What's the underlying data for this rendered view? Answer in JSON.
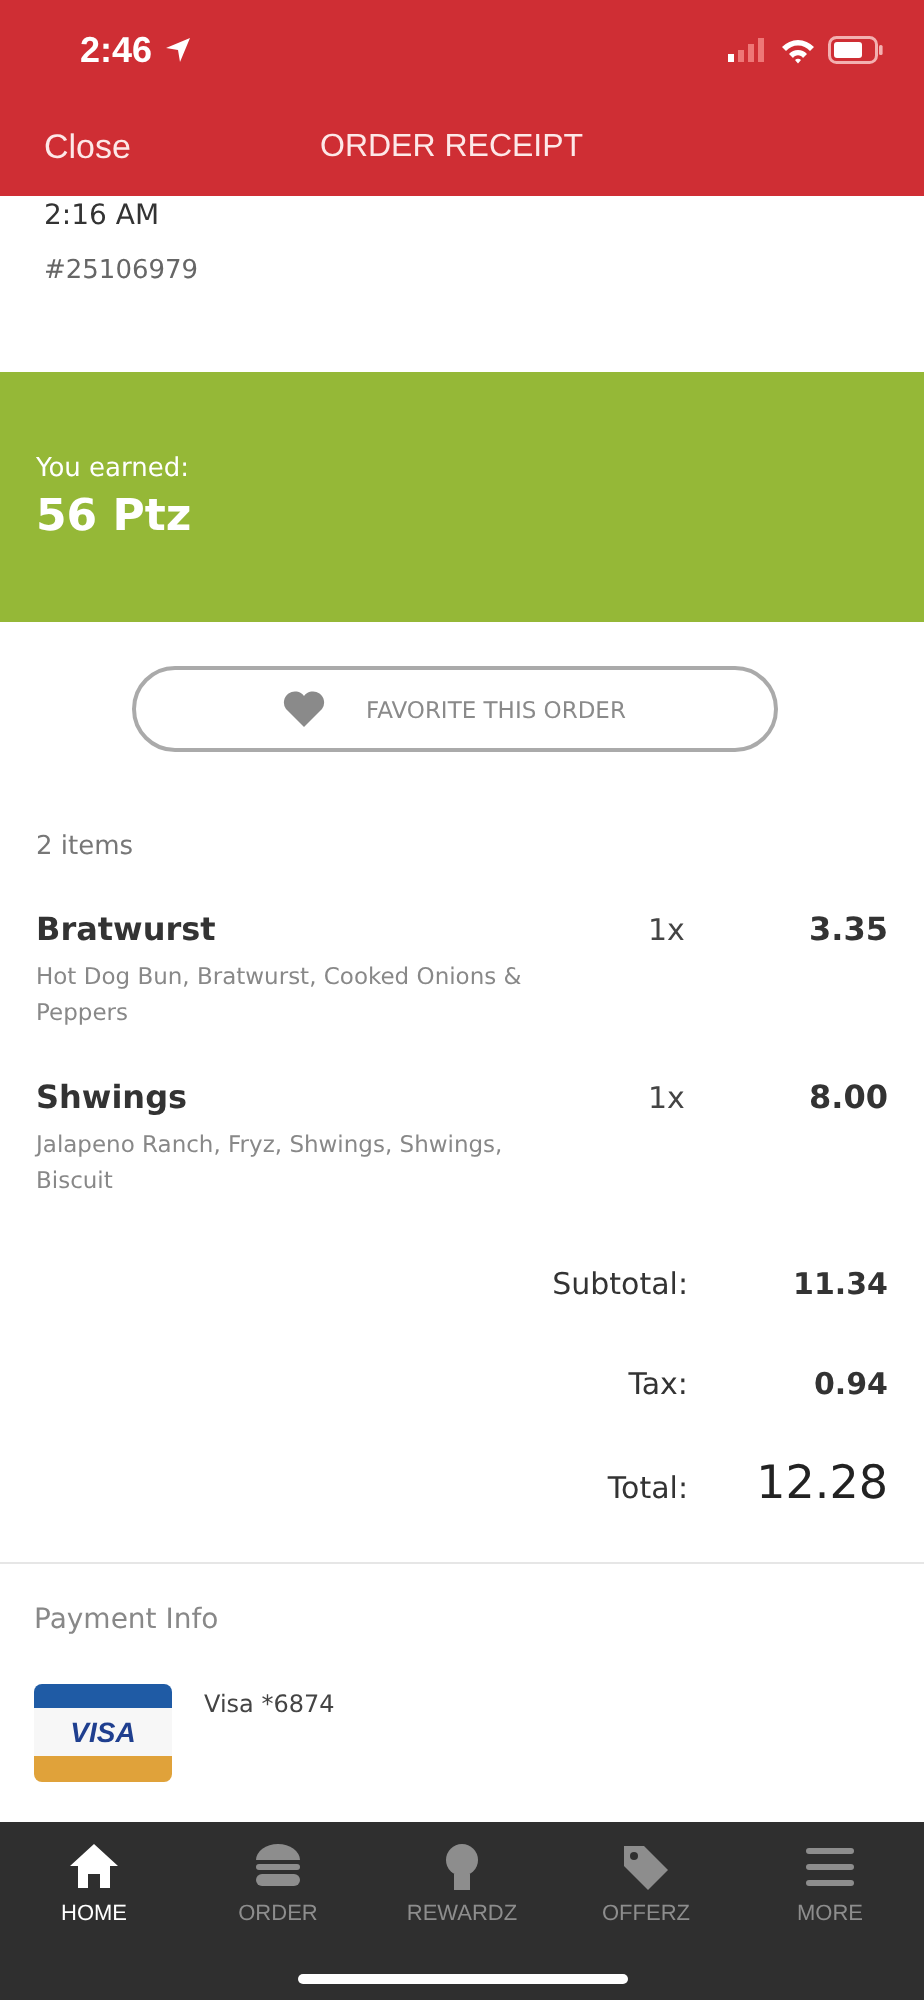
{
  "status_bar": {
    "time": "2:46"
  },
  "nav": {
    "close": "Close",
    "title": "ORDER RECEIPT"
  },
  "order": {
    "time": "2:16 AM",
    "number": "#25106979"
  },
  "earned": {
    "label": "You earned:",
    "points": "56 Ptz"
  },
  "favorite_button": {
    "label": "FAVORITE THIS ORDER"
  },
  "items_count": "2 items",
  "items": [
    {
      "name": "Bratwurst",
      "quantity": "1x",
      "price": "3.35",
      "details": "Hot Dog Bun, Bratwurst, Cooked Onions & Peppers"
    },
    {
      "name": "Shwings",
      "quantity": "1x",
      "price": "8.00",
      "details": "Jalapeno Ranch, Fryz, Shwings, Shwings, Biscuit"
    }
  ],
  "totals": [
    {
      "kind": "line",
      "label": "Subtotal:",
      "value": "11.34"
    },
    {
      "kind": "line",
      "label": "Tax:",
      "value": "0.94"
    },
    {
      "kind": "grand",
      "label": "Total:",
      "value": "12.28"
    }
  ],
  "payment": {
    "heading": "Payment Info",
    "card_brand": "VISA",
    "card": "Visa *6874"
  },
  "tab_bar": [
    {
      "kind": "home",
      "label": "HOME",
      "selected": true
    },
    {
      "kind": "order",
      "label": "ORDER",
      "selected": false
    },
    {
      "kind": "rewards",
      "label": "REWARDZ",
      "selected": false
    },
    {
      "kind": "offers",
      "label": "OFFERZ",
      "selected": false
    },
    {
      "kind": "more",
      "label": "MORE",
      "selected": false
    }
  ]
}
